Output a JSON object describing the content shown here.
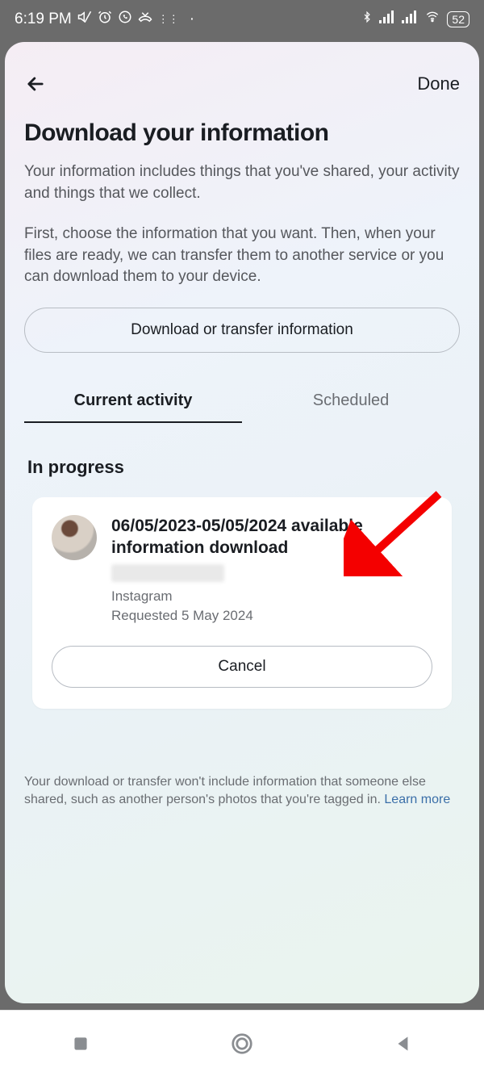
{
  "status_bar": {
    "time": "6:19 PM",
    "battery": "52"
  },
  "header": {
    "done_label": "Done"
  },
  "page_title": "Download your information",
  "intro_1": "Your information includes things that you've shared, your activity and things that we collect.",
  "intro_2": "First, choose the information that you want. Then, when your files are ready, we can transfer them to another service or you can download them to your device.",
  "main_button": "Download or transfer information",
  "tabs": {
    "current": "Current activity",
    "scheduled": "Scheduled"
  },
  "section_heading": "In progress",
  "card": {
    "title": "06/05/2023-05/05/2024 available information download",
    "platform": "Instagram",
    "requested": "Requested 5 May 2024",
    "cancel_label": "Cancel"
  },
  "footer": {
    "text": "Your download or transfer won't include information that someone else shared, such as another person's photos that you're tagged in. ",
    "learn_more": "Learn more"
  }
}
